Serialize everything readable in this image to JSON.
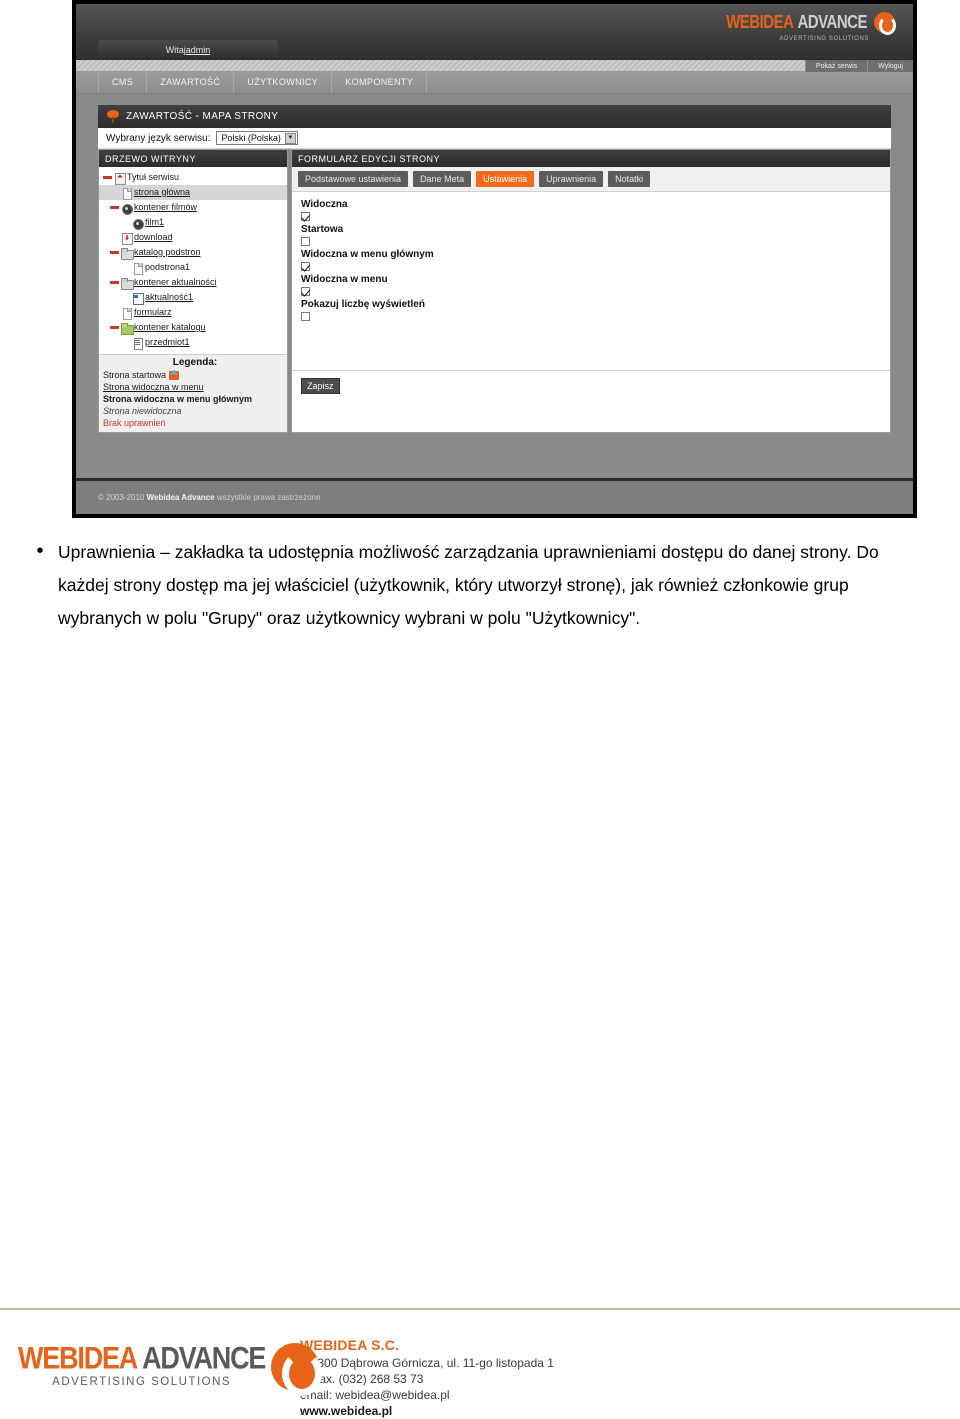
{
  "screenshot": {
    "brand": {
      "word1": "WEBIDEA",
      "word2": "ADVANCE",
      "tagline": "ADVERTISING SOLUTIONS"
    },
    "welcome_tab": {
      "prefix": "Witaj ",
      "user": "admin"
    },
    "strip_links": [
      {
        "label": "Pokaż serwis"
      },
      {
        "label": "Wyloguj"
      }
    ],
    "main_nav": [
      {
        "label": "CMS"
      },
      {
        "label": "ZAWARTOŚĆ"
      },
      {
        "label": "UŻYTKOWNICY"
      },
      {
        "label": "KOMPONENTY"
      }
    ],
    "panel_title": "ZAWARTOŚĆ - MAPA STRONY",
    "language_bar": {
      "label": "Wybrany język serwisu:",
      "selected": "Polski (Polska)",
      "arrow": "▼"
    },
    "tree_panel": {
      "header": "DRZEWO WITRYNY",
      "nodes": [
        {
          "label": "Tytuł serwisu",
          "indent": 0,
          "toggle": "minus",
          "icon": "home",
          "style": "plain",
          "selected": false
        },
        {
          "label": "strona główna",
          "indent": 1,
          "toggle": "blank",
          "icon": "page",
          "style": "underline",
          "selected": true
        },
        {
          "label": "kontener filmów",
          "indent": 1,
          "toggle": "minus",
          "icon": "video",
          "style": "underline",
          "selected": false
        },
        {
          "label": "film1",
          "indent": 2,
          "toggle": "blank",
          "icon": "video",
          "style": "underline",
          "selected": false
        },
        {
          "label": "download",
          "indent": 1,
          "toggle": "blank",
          "icon": "dl",
          "style": "underline",
          "selected": false
        },
        {
          "label": "katalog podstron",
          "indent": 1,
          "toggle": "minus",
          "icon": "folder",
          "style": "underline",
          "selected": false
        },
        {
          "label": "podstrona1",
          "indent": 2,
          "toggle": "blank",
          "icon": "page",
          "style": "plain",
          "selected": false
        },
        {
          "label": "kontener aktualności",
          "indent": 1,
          "toggle": "minus",
          "icon": "folder",
          "style": "underline",
          "selected": false
        },
        {
          "label": "aktualność1",
          "indent": 2,
          "toggle": "blank",
          "icon": "news",
          "style": "underline",
          "selected": false
        },
        {
          "label": "formularz",
          "indent": 1,
          "toggle": "blank",
          "icon": "page",
          "style": "underline",
          "selected": false
        },
        {
          "label": "kontener katalogu",
          "indent": 1,
          "toggle": "minus",
          "icon": "greenfolder",
          "style": "underline",
          "selected": false
        },
        {
          "label": "przedmiot1",
          "indent": 2,
          "toggle": "blank",
          "icon": "item",
          "style": "underline",
          "selected": false
        }
      ],
      "legend": {
        "title": "Legenda:",
        "items": [
          {
            "label": "Strona startowa",
            "style": "plain",
            "has_home_icon": true
          },
          {
            "label": "Strona widoczna w menu",
            "style": "underline",
            "has_home_icon": false
          },
          {
            "label": "Strona widoczna w menu głównym",
            "style": "bold",
            "has_home_icon": false
          },
          {
            "label": "Strona niewidoczna",
            "style": "italic",
            "has_home_icon": false
          },
          {
            "label": "Brak uprawnień",
            "style": "red",
            "has_home_icon": false
          }
        ]
      }
    },
    "form_panel": {
      "header": "FORMULARZ EDYCJI STRONY",
      "tabs": [
        {
          "label": "Podstawowe ustawienia",
          "active": false
        },
        {
          "label": "Dane Meta",
          "active": false
        },
        {
          "label": "Ustawienia",
          "active": true
        },
        {
          "label": "Uprawnienia",
          "active": false
        },
        {
          "label": "Notatki",
          "active": false
        }
      ],
      "fields": [
        {
          "label": "Widoczna",
          "checked": true
        },
        {
          "label": "Startowa",
          "checked": false
        },
        {
          "label": "Widoczna w menu głównym",
          "checked": true
        },
        {
          "label": "Widoczna w menu",
          "checked": true
        },
        {
          "label": "Pokazuj liczbę wyświetleń",
          "checked": false
        }
      ],
      "save_button": "Zapisz"
    },
    "app_footer": {
      "copyright_prefix": "© 2003-2010 ",
      "brand": "Webidea Advance",
      "suffix": " wszystkie prawa zastrzeżone"
    },
    "colors": {
      "accent_orange": "#e8631a",
      "tab_active": "#f26a1b",
      "legend_red": "#c0392b"
    }
  },
  "document": {
    "bullet": "•",
    "paragraph": "Uprawnienia – zakładka ta udostępnia możliwość zarządzania uprawnieniami dostępu do danej strony. Do każdej strony dostęp ma jej właściciel (użytkownik, który utworzył stronę), jak również członkowie grup wybranych w polu \"Grupy\" oraz użytkownicy wybrani w polu \"Użytkownicy\"."
  },
  "page_footer": {
    "logo": {
      "word1": "WEBIDEA",
      "word2": "ADVANCE",
      "tagline": "ADVERTISING SOLUTIONS"
    },
    "company": "WEBIDEA S.C.",
    "address": "41-300 Dąbrowa Górnicza, ul. 11-go listopada 1",
    "phone": "tel/fax. (032) 268 53 73",
    "email": "email: webidea@webidea.pl",
    "website": "www.webidea.pl"
  }
}
